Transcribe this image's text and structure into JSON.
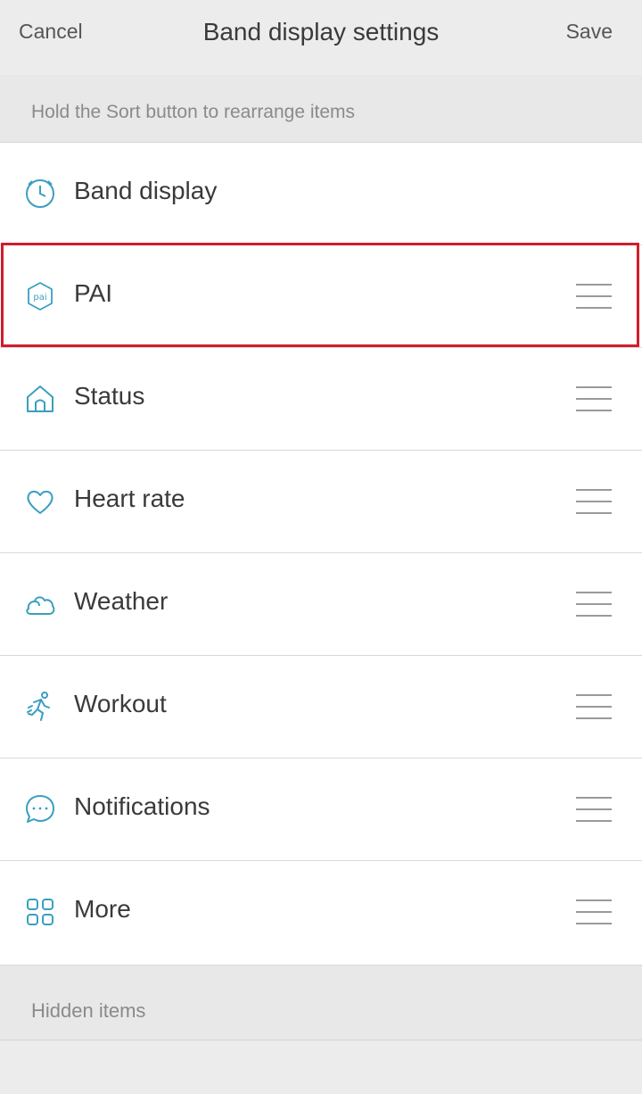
{
  "navbar": {
    "cancel_label": "Cancel",
    "title": "Band display settings",
    "save_label": "Save"
  },
  "hint": "Hold the Sort button to rearrange items",
  "items": [
    {
      "label": "Band display",
      "icon": "clock-icon",
      "sortable": false
    },
    {
      "label": "PAI",
      "icon": "pai-icon",
      "sortable": true,
      "highlighted": true
    },
    {
      "label": "Status",
      "icon": "home-icon",
      "sortable": true
    },
    {
      "label": "Heart rate",
      "icon": "heart-icon",
      "sortable": true
    },
    {
      "label": "Weather",
      "icon": "cloud-icon",
      "sortable": true
    },
    {
      "label": "Workout",
      "icon": "runner-icon",
      "sortable": true
    },
    {
      "label": "Notifications",
      "icon": "chat-bubble-icon",
      "sortable": true
    },
    {
      "label": "More",
      "icon": "grid-icon",
      "sortable": true
    }
  ],
  "hidden_section_label": "Hidden items",
  "colors": {
    "icon_accent": "#3a9fbf",
    "highlight_border": "#d21d2b",
    "background": "#ececed"
  }
}
